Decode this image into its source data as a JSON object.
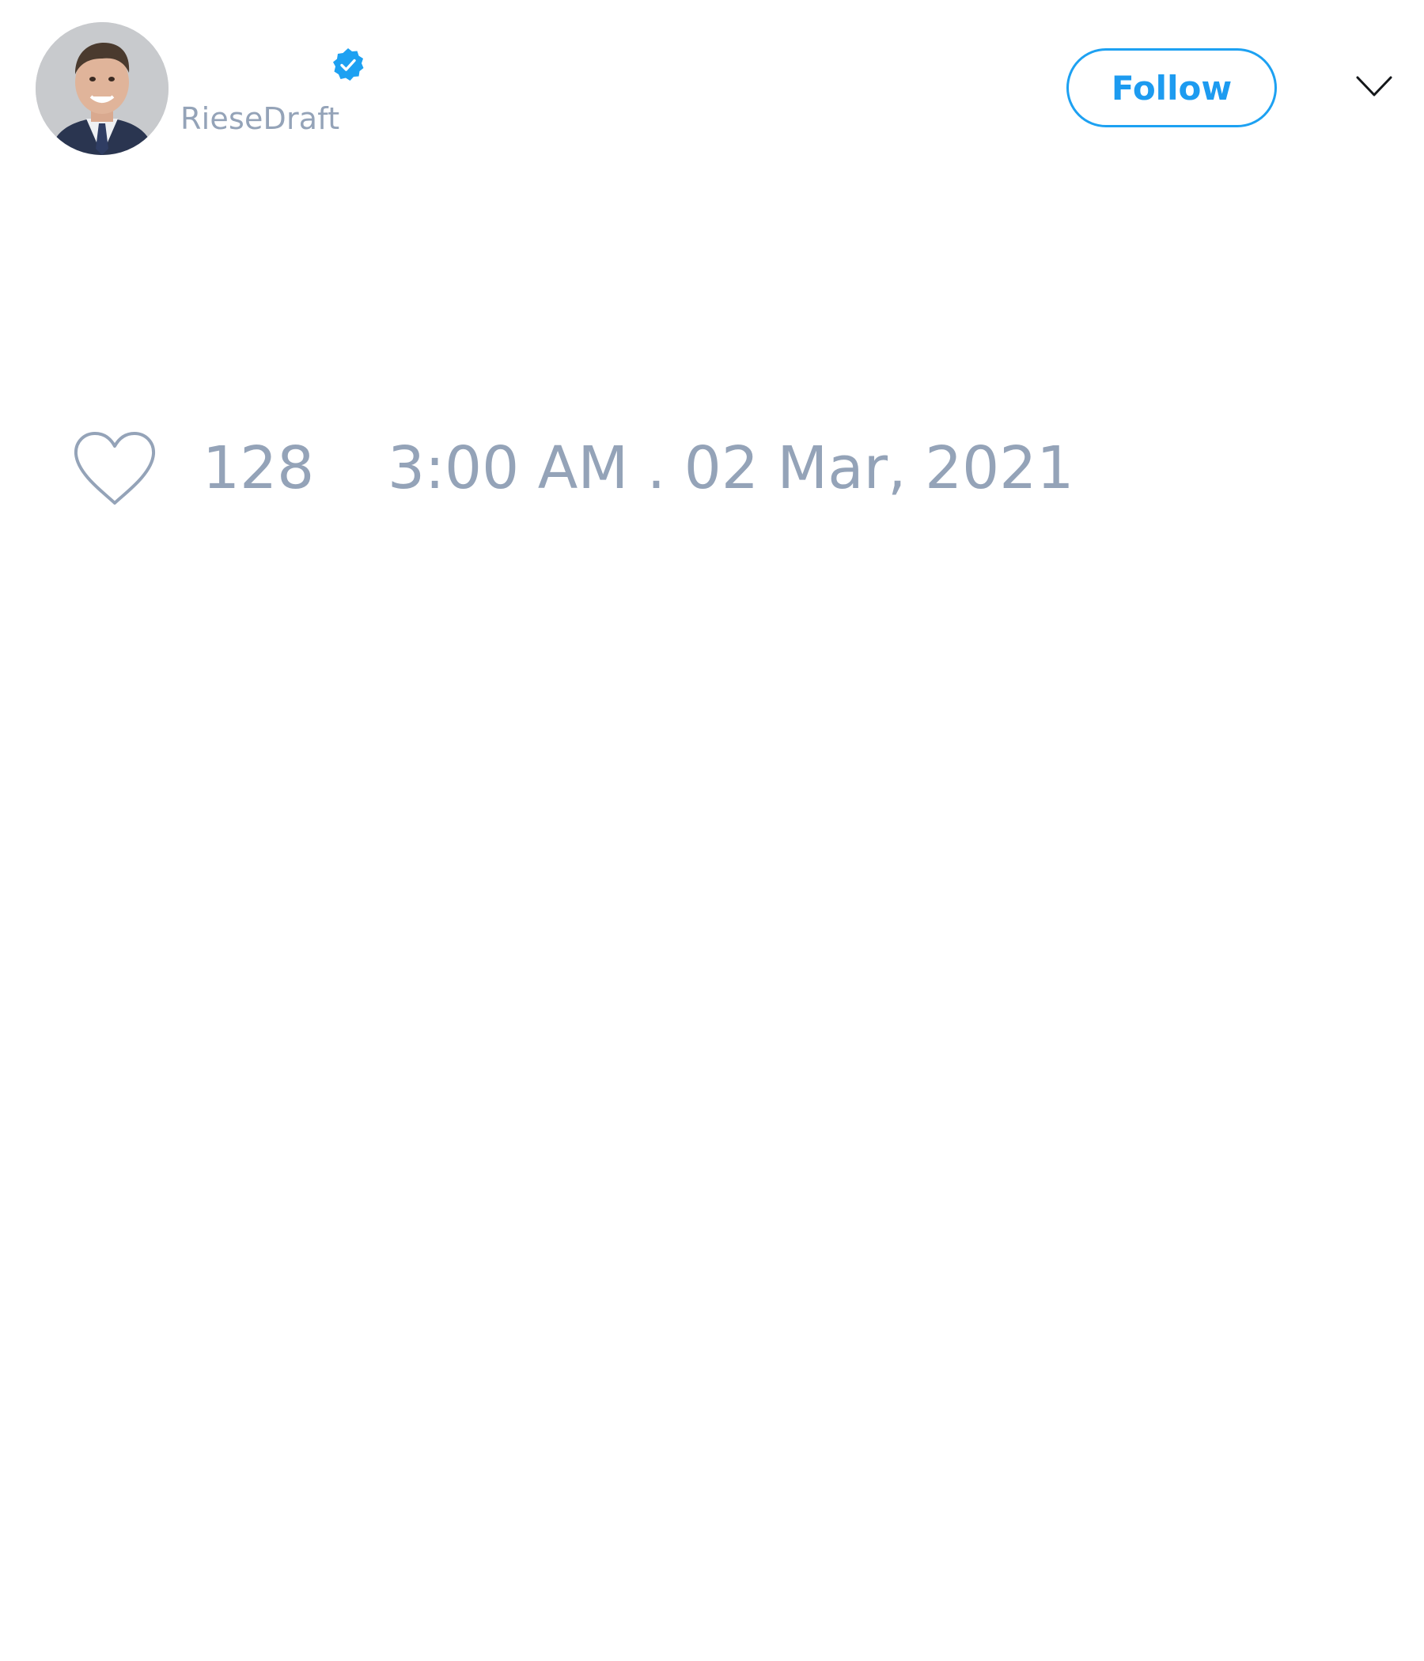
{
  "tweet": {
    "author": {
      "display_name": "",
      "username": "RieseDraft",
      "verified": true,
      "avatar_icon": "profile-photo"
    },
    "follow_label": "Follow",
    "menu_icon": "chevron-down-icon",
    "like_icon": "heart-icon",
    "like_count": "128",
    "timestamp": "3:00 AM . 02 Mar, 2021"
  },
  "colors": {
    "accent": "#1da1f2",
    "muted_text": "#94a3b8",
    "background": "#ffffff"
  }
}
